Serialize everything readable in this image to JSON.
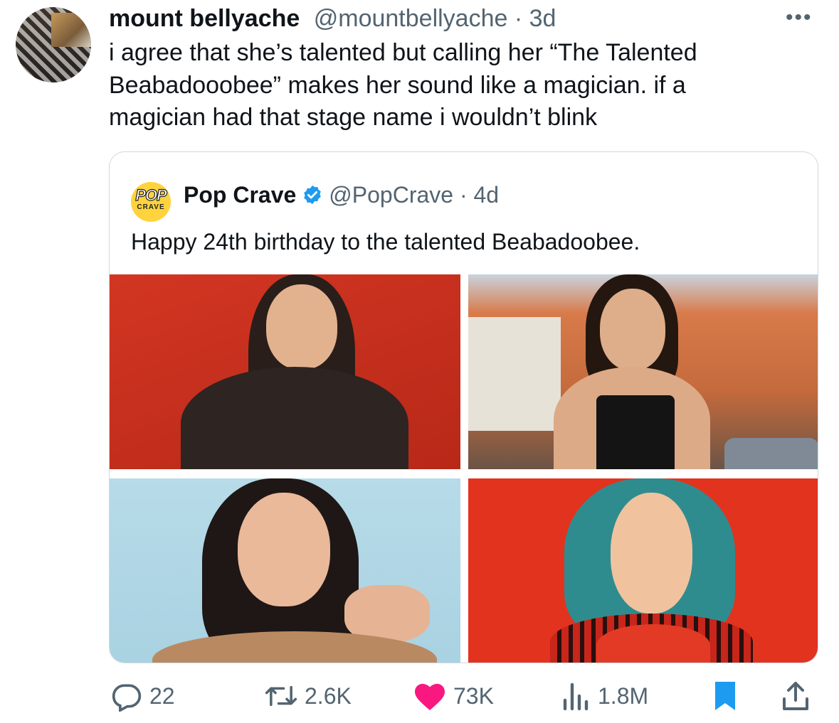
{
  "tweet": {
    "author_name": "mount bellyache",
    "author_handle": "@mountbellyache",
    "age": "3d",
    "text": "i agree that she’s talented but calling her “The Talented\nBeabadooobee” makes her sound like a magician. if a\nmagician had that stage name i wouldn’t blink",
    "more_icon": "more-icon"
  },
  "quote": {
    "author_name": "Pop Crave",
    "logo_text_top": "POP",
    "logo_text_bottom": "CRAVE",
    "verified_icon": "verified-badge-icon",
    "author_handle": "@PopCrave",
    "age": "4d",
    "text": "Happy 24th birthday to the talented Beabadoobee.",
    "photos": [
      "photo-red-background",
      "photo-street",
      "photo-blue-background",
      "photo-teal-hair-red-background"
    ]
  },
  "actions": {
    "replies": "22",
    "reposts": "2.6K",
    "likes": "73K",
    "views": "1.8M",
    "bookmarked": true,
    "icons": [
      "reply-icon",
      "repost-icon",
      "like-icon",
      "views-icon",
      "bookmark-icon",
      "share-icon"
    ]
  },
  "colors": {
    "like": "#f91880",
    "bookmark": "#1d9bf0",
    "verified": "#1d9bf0",
    "secondary_text": "#536471"
  }
}
